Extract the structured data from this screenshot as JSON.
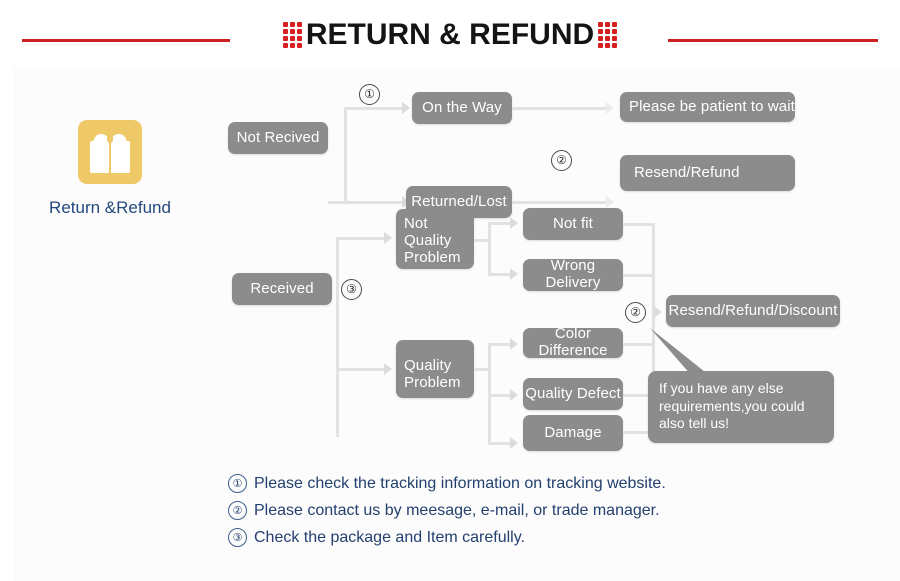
{
  "header": {
    "title": "RETURN & REFUND",
    "accent_color": "#cc2222",
    "dot_color": "#d81f1f"
  },
  "icon_block": {
    "icon_name": "gift-box-icon",
    "label": "Return &Refund",
    "icon_color": "#efc967",
    "label_color": "#24497e"
  },
  "flow": {
    "node_color": "#8c8c8c",
    "connector_color": "#e2e2e2",
    "nodes": {
      "not_recived": "Not Recived",
      "on_the_way": "On the Way",
      "returned_lost": "Returned/Lost",
      "please_be_patient": "Please be patient to wait",
      "resend_refund": "Resend/Refund",
      "received": "Received",
      "not_quality_problem": "Not\nQuality\nProblem",
      "not_quality_problem_l1": "Not",
      "not_quality_problem_l2": "Quality",
      "not_quality_problem_l3": "Problem",
      "not_fit": "Not fit",
      "wrong_delivery": "Wrong Delivery",
      "quality_problem_l1": "Quality",
      "quality_problem_l2": "Problem",
      "color_difference": "Color Difference",
      "quality_defect": "Quality Defect",
      "damage": "Damage",
      "resend_refund_discount": "Resend/Refund/Discount"
    },
    "markers": {
      "m1": "①",
      "m2_top": "②",
      "m3": "③",
      "m2_right": "②"
    },
    "bubble": {
      "line1": "If you have any else",
      "line2": "requirements,you could",
      "line3": "also tell us!"
    }
  },
  "notes": [
    {
      "num": "①",
      "text": "Please check the tracking information on tracking website."
    },
    {
      "num": "②",
      "text": "Please contact us by meesage, e-mail, or trade manager."
    },
    {
      "num": "③",
      "text": "Check the package and Item carefully."
    }
  ]
}
